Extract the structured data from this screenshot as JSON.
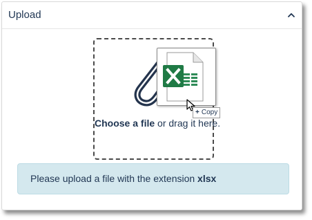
{
  "panel": {
    "title": "Upload",
    "collapse_icon": "chevron-up-icon"
  },
  "dropzone": {
    "choose_label": "Choose a file",
    "drag_label": " or drag it here.",
    "copy_tooltip": "Copy",
    "copy_symbol": "+",
    "icons": [
      "paperclip-icon",
      "excel-file-icon",
      "cursor-icon"
    ]
  },
  "info": {
    "message": "Please upload a file with the extension ",
    "extension": "xlsx"
  },
  "colors": {
    "text": "#1f3552",
    "info_background": "#d4e8ee",
    "excel_green": "#1f7a45",
    "paperclip": "#24344d"
  }
}
